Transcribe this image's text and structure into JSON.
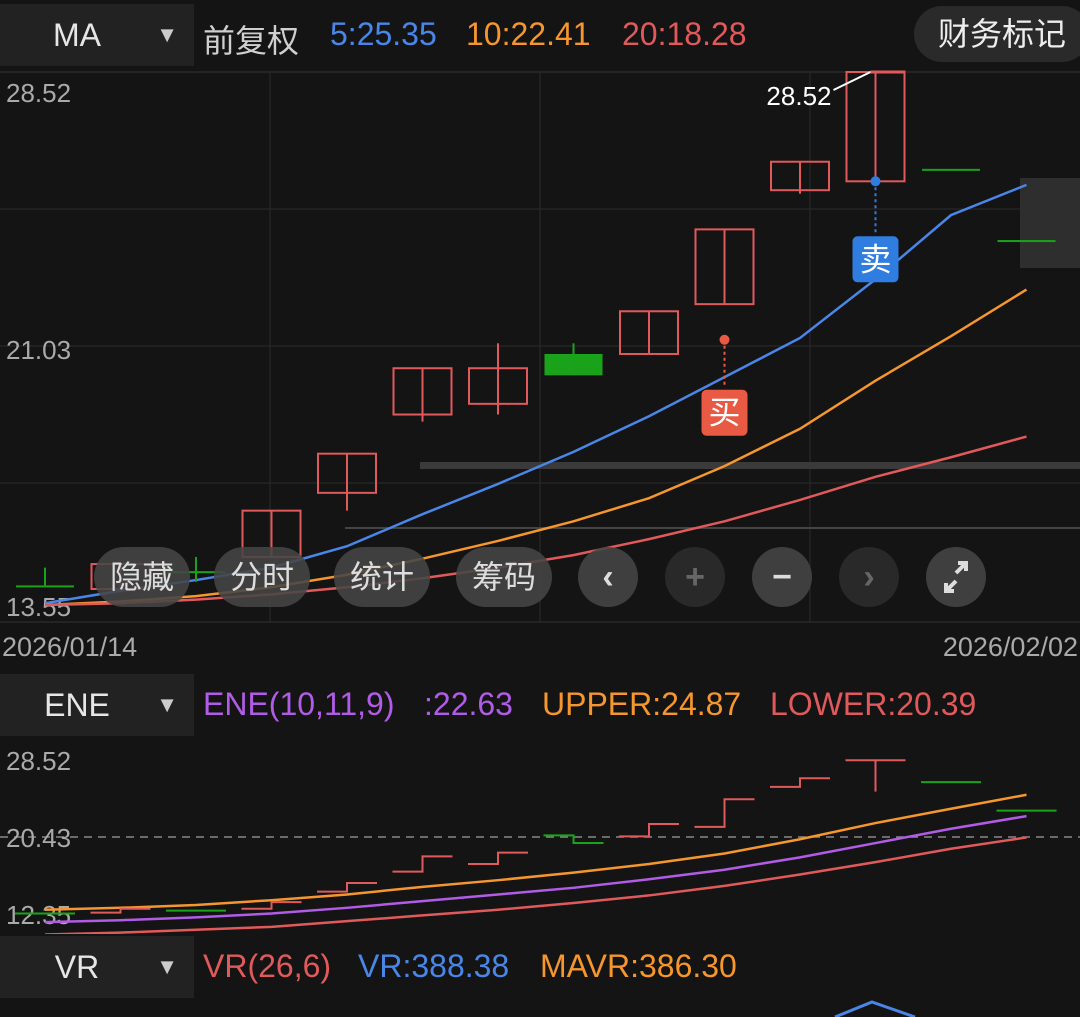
{
  "main_header": {
    "indicator": "MA",
    "adjust": "前复权",
    "ma5": "5:25.35",
    "ma10": "10:22.41",
    "ma20": "20:18.28",
    "finance_button": "财务标记",
    "colors": {
      "ma5": "#4a86e8",
      "ma10": "#f5962f",
      "ma20": "#e0595b"
    }
  },
  "ene_header": {
    "indicator": "ENE",
    "name": "ENE(10,11,9)",
    "value": ":22.63",
    "upper": "UPPER:24.87",
    "lower": "LOWER:20.39"
  },
  "vr_header": {
    "indicator": "VR",
    "name": "VR(26,6)",
    "vr": "VR:388.38",
    "mavr": "MAVR:386.30"
  },
  "overlay": {
    "hide": "隐藏",
    "timeshare": "分时",
    "stats": "统计",
    "chips": "筹码",
    "prev_icon": "chevron-left",
    "zoom_in_icon": "plus",
    "zoom_out_icon": "minus",
    "next_icon": "chevron-right",
    "fullscreen_icon": "expand"
  },
  "chart_data": [
    {
      "type": "candlestick",
      "title": "MA",
      "y_ticks": [
        "28.52",
        "21.03",
        "13.55"
      ],
      "ylim": [
        13.55,
        28.52
      ],
      "x_labels": [
        "2026/01/14",
        "2026/02/02"
      ],
      "candles": [
        {
          "o": 14.1,
          "c": 14.1,
          "h": 14.6,
          "l": 14.1,
          "dir": "down"
        },
        {
          "o": 14.0,
          "c": 14.7,
          "h": 14.7,
          "l": 14.0,
          "dir": "up"
        },
        {
          "o": 14.5,
          "c": 14.5,
          "h": 14.9,
          "l": 14.2,
          "dir": "down"
        },
        {
          "o": 14.9,
          "c": 16.2,
          "h": 16.2,
          "l": 14.9,
          "dir": "up"
        },
        {
          "o": 16.7,
          "c": 17.8,
          "h": 17.8,
          "l": 16.2,
          "dir": "up"
        },
        {
          "o": 18.9,
          "c": 20.2,
          "h": 20.2,
          "l": 18.7,
          "dir": "up"
        },
        {
          "o": 19.2,
          "c": 20.2,
          "h": 20.9,
          "l": 18.9,
          "dir": "up"
        },
        {
          "o": 20.6,
          "c": 20.0,
          "h": 20.9,
          "l": 20.0,
          "dir": "down"
        },
        {
          "o": 20.6,
          "c": 21.8,
          "h": 21.8,
          "l": 20.6,
          "dir": "up"
        },
        {
          "o": 22.0,
          "c": 24.1,
          "h": 24.1,
          "l": 22.0,
          "dir": "up"
        },
        {
          "o": 25.2,
          "c": 26.0,
          "h": 26.0,
          "l": 25.1,
          "dir": "up"
        },
        {
          "o": 25.45,
          "c": 28.52,
          "h": 28.52,
          "l": 25.45,
          "dir": "up"
        },
        {
          "o": 25.8,
          "c": 25.8,
          "h": 25.8,
          "l": 25.8,
          "dir": "down"
        },
        {
          "o": 23.8,
          "c": 23.8,
          "h": 23.8,
          "l": 23.8,
          "dir": "down"
        }
      ],
      "series": [
        {
          "name": "MA5",
          "color": "#4a86e8",
          "values": [
            13.6,
            13.95,
            14.25,
            14.6,
            15.2,
            16.1,
            16.95,
            17.85,
            18.85,
            19.95,
            21.05,
            22.7,
            24.5,
            25.35
          ]
        },
        {
          "name": "MA10",
          "color": "#f5962f",
          "values": [
            13.55,
            13.65,
            13.8,
            14.05,
            14.4,
            14.85,
            15.35,
            15.9,
            16.55,
            17.45,
            18.5,
            19.85,
            21.1,
            22.41
          ]
        },
        {
          "name": "MA20",
          "color": "#e0595b",
          "values": [
            13.55,
            13.6,
            13.7,
            13.85,
            14.05,
            14.3,
            14.6,
            14.95,
            15.4,
            15.9,
            16.5,
            17.15,
            17.7,
            18.28
          ]
        }
      ],
      "annotations": [
        {
          "label": "28.52",
          "type": "high",
          "x": 11,
          "y": 28.52
        },
        {
          "label": "买",
          "type": "buy",
          "x": 9,
          "y": 21.0
        },
        {
          "label": "卖",
          "type": "sell",
          "x": 11,
          "y": 25.45
        }
      ]
    },
    {
      "type": "candlestick",
      "title": "ENE(10,11,9)",
      "y_ticks": [
        "28.52",
        "20.43",
        "12.35"
      ],
      "ylim": [
        12.35,
        28.52
      ],
      "dashed_line": 20.43,
      "candles": [
        {
          "o": 12.4,
          "c": 12.4,
          "h": 12.4,
          "l": 12.4,
          "dir": "down"
        },
        {
          "o": 12.5,
          "c": 12.9,
          "h": 12.9,
          "l": 12.5,
          "dir": "up"
        },
        {
          "o": 12.7,
          "c": 12.7,
          "h": 12.7,
          "l": 12.7,
          "dir": "down"
        },
        {
          "o": 12.9,
          "c": 13.6,
          "h": 13.6,
          "l": 12.9,
          "dir": "up"
        },
        {
          "o": 14.7,
          "c": 15.6,
          "h": 15.6,
          "l": 14.7,
          "dir": "up"
        },
        {
          "o": 16.8,
          "c": 18.4,
          "h": 18.4,
          "l": 16.8,
          "dir": "up"
        },
        {
          "o": 17.6,
          "c": 18.8,
          "h": 19.2,
          "l": 17.6,
          "dir": "up"
        },
        {
          "o": 20.6,
          "c": 19.8,
          "h": 20.6,
          "l": 19.8,
          "dir": "down"
        },
        {
          "o": 20.5,
          "c": 21.8,
          "h": 21.8,
          "l": 20.5,
          "dir": "up"
        },
        {
          "o": 21.5,
          "c": 24.4,
          "h": 24.4,
          "l": 21.5,
          "dir": "up"
        },
        {
          "o": 25.7,
          "c": 26.6,
          "h": 26.6,
          "l": 25.7,
          "dir": "up"
        },
        {
          "o": 28.5,
          "c": 28.5,
          "h": 28.5,
          "l": 25.2,
          "dir": "up"
        },
        {
          "o": 26.2,
          "c": 26.2,
          "h": 26.2,
          "l": 26.2,
          "dir": "down"
        },
        {
          "o": 23.2,
          "c": 23.2,
          "h": 23.2,
          "l": 23.2,
          "dir": "down"
        }
      ],
      "series": [
        {
          "name": "UPPER",
          "color": "#f5962f",
          "values": [
            12.8,
            13.0,
            13.3,
            13.8,
            14.4,
            15.2,
            15.9,
            16.7,
            17.6,
            18.7,
            20.2,
            21.9,
            23.4,
            24.87
          ]
        },
        {
          "name": "ENE",
          "color": "#b05ce6",
          "values": [
            11.5,
            11.7,
            12.0,
            12.4,
            13.0,
            13.7,
            14.4,
            15.1,
            16.0,
            17.0,
            18.3,
            19.8,
            21.3,
            22.63
          ]
        },
        {
          "name": "LOWER",
          "color": "#e0595b",
          "values": [
            10.2,
            10.4,
            10.7,
            11.0,
            11.6,
            12.2,
            12.8,
            13.5,
            14.3,
            15.3,
            16.5,
            17.8,
            19.2,
            20.39
          ]
        }
      ]
    }
  ]
}
